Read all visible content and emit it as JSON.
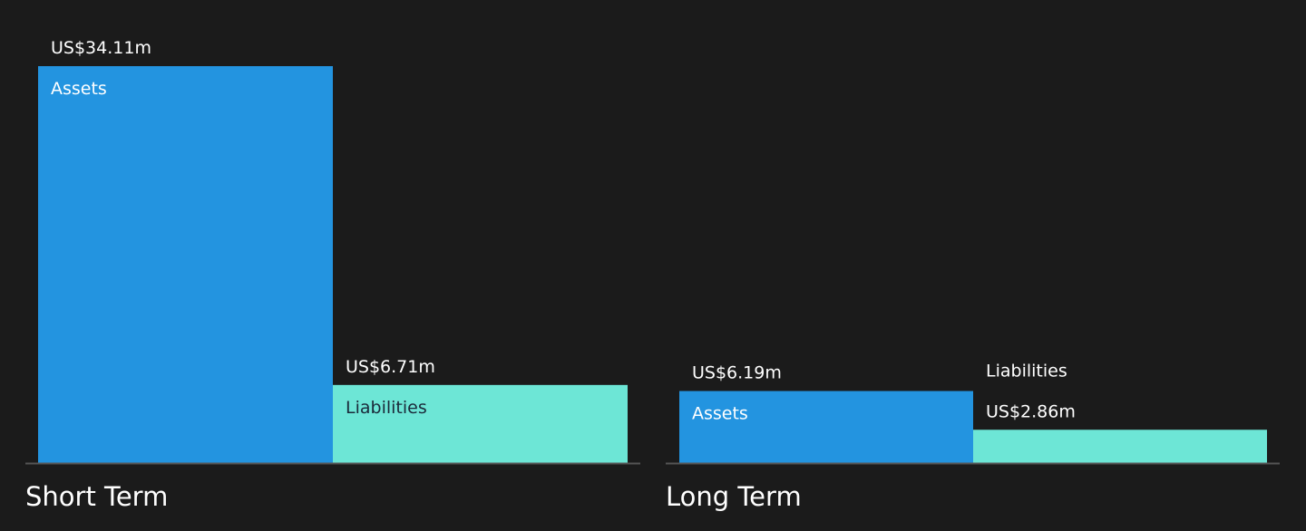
{
  "chart_data": [
    {
      "type": "bar",
      "title": "Short Term",
      "categories": [
        "Assets",
        "Liabilities"
      ],
      "values": [
        34.11,
        6.71
      ],
      "value_labels": [
        "US$34.11m",
        "US$6.71m"
      ],
      "unit": "US$m"
    },
    {
      "type": "bar",
      "title": "Long Term",
      "categories": [
        "Assets",
        "Liabilities"
      ],
      "values": [
        6.19,
        2.86
      ],
      "value_labels": [
        "US$6.19m",
        "US$2.86m"
      ],
      "unit": "US$m"
    }
  ],
  "colors": {
    "background": "#1b1b1b",
    "assets": "#2394e0",
    "liabilities": "#6de6d6",
    "axis": "#555555",
    "text_light": "#ffffff",
    "text_dark": "#1b2a3a"
  }
}
